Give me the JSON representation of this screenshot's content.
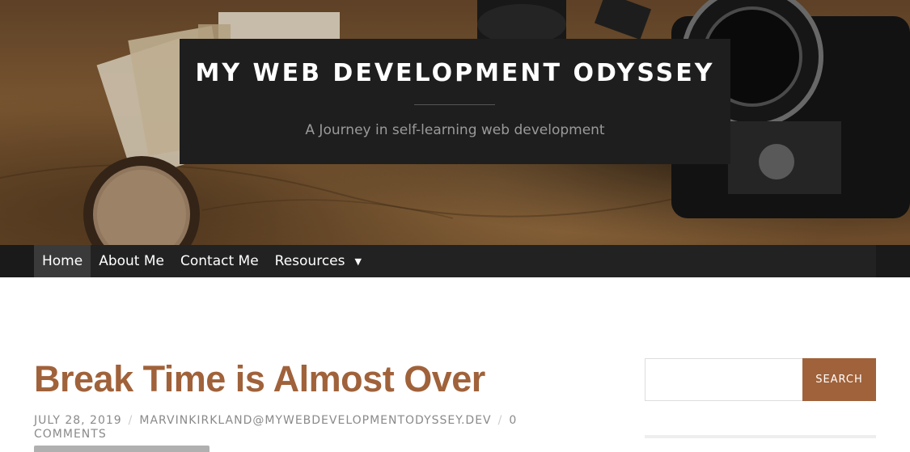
{
  "header": {
    "site_title": "MY WEB DEVELOPMENT ODYSSEY",
    "tagline": "A Journey in self-learning web development"
  },
  "nav": {
    "items": [
      {
        "label": "Home",
        "active": true
      },
      {
        "label": "About Me",
        "active": false
      },
      {
        "label": "Contact Me",
        "active": false
      },
      {
        "label": "Resources",
        "active": false,
        "has_dropdown": true
      }
    ],
    "caret_icon": "caret-down-icon"
  },
  "post": {
    "title": "Break Time is Almost Over",
    "date": "JULY 28, 2019",
    "author": "MARVINKIRKLAND@MYWEBDEVELOPMENTODYSSEY.DEV",
    "comments": "0 COMMENTS",
    "separator": "/"
  },
  "sidebar": {
    "search": {
      "placeholder": "",
      "value": "",
      "button_label": "SEARCH"
    }
  },
  "colors": {
    "accent": "#a0623a",
    "nav_bg": "#222222",
    "title_box_bg": "#1e1e1e"
  }
}
